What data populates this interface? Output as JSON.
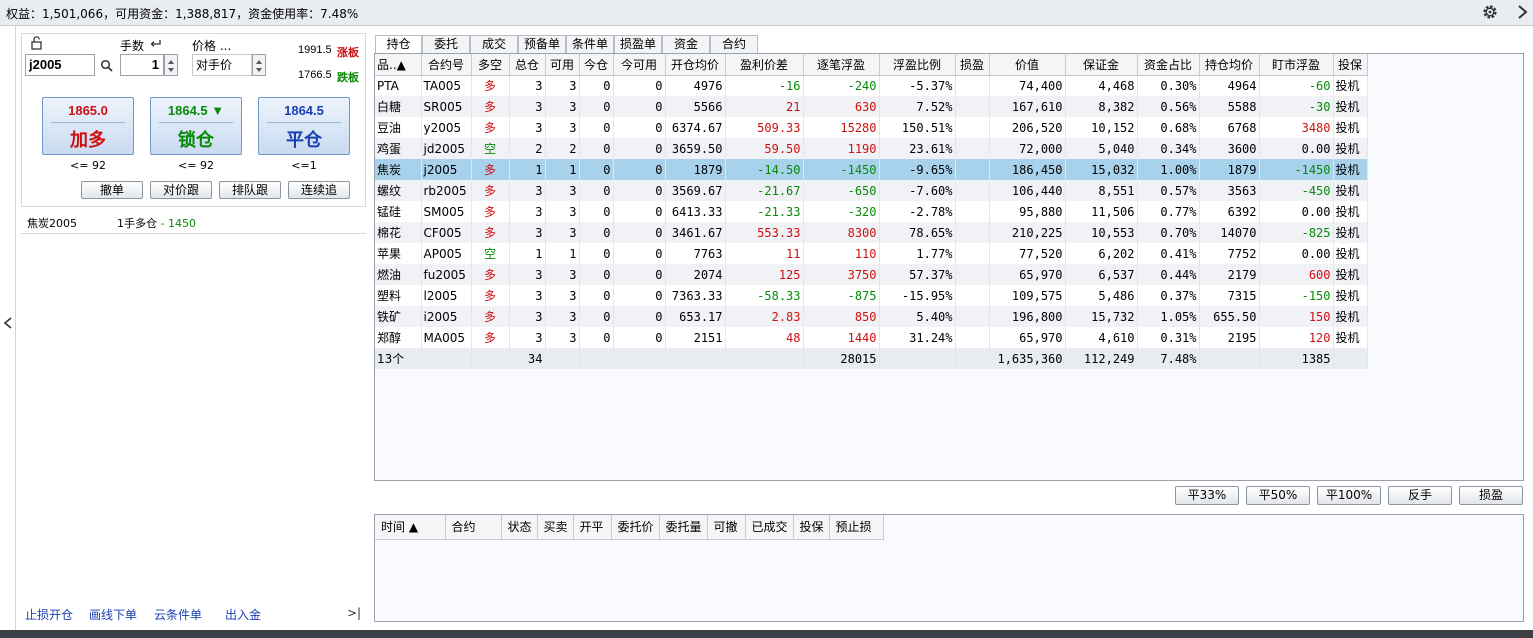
{
  "summary": {
    "text": "权益：1,501,066，可用资金：1,388,817，资金使用率：7.48%"
  },
  "icons": {
    "gear": "gear-icon",
    "more": "chevron-right-icon",
    "collapse": "chevron-left-icon",
    "unlock": "unlock-icon",
    "search": "search-icon",
    "return": "return-icon"
  },
  "order": {
    "qty_label": "手数",
    "price_label": "价格 ...",
    "contract": "j2005",
    "qty": "1",
    "price_value": "对手价",
    "limit_up": "1991.5",
    "limit_up_label": "涨板",
    "limit_down": "1766.5",
    "limit_down_label": "跌板",
    "buttons": [
      {
        "price": "1865.0",
        "label": "加多",
        "limit": "<= 92"
      },
      {
        "price": "1864.5 ▼",
        "label": "锁仓",
        "limit": "<= 92"
      },
      {
        "price": "1864.5",
        "label": "平仓",
        "limit": "<=1"
      }
    ],
    "small_buttons": [
      "撤单",
      "对价跟",
      "排队跟",
      "连续追"
    ]
  },
  "info": {
    "name": "焦炭2005",
    "pos": "1手多仓",
    "dash": " - ",
    "pl": "1450"
  },
  "bottom_links": [
    "止损开仓",
    "画线下单",
    "云条件单",
    "出入金"
  ],
  "bottom_end": ">|",
  "tabs": [
    "持仓",
    "委托",
    "成交",
    "预备单",
    "条件单",
    "损盈单",
    "资金",
    "合约"
  ],
  "positions": {
    "columns": [
      "品..▲",
      "合约号",
      "多空",
      "总仓",
      "可用",
      "今仓",
      "今可用",
      "开仓均价",
      "盈利价差",
      "逐笔浮盈",
      "浮盈比例",
      "损盈",
      "价值",
      "保证金",
      "资金占比",
      "持仓均价",
      "盯市浮盈",
      "投保"
    ],
    "rows": [
      [
        "PTA",
        "TA005",
        "多",
        "3",
        "3",
        "0",
        "0",
        "4976",
        "-16",
        "-240",
        "-5.37%",
        "",
        "74,400",
        "4,468",
        "0.30%",
        "4964",
        "-60",
        "投机"
      ],
      [
        "白糖",
        "SR005",
        "多",
        "3",
        "3",
        "0",
        "0",
        "5566",
        "21",
        "630",
        "7.52%",
        "",
        "167,610",
        "8,382",
        "0.56%",
        "5588",
        "-30",
        "投机"
      ],
      [
        "豆油",
        "y2005",
        "多",
        "3",
        "3",
        "0",
        "0",
        "6374.67",
        "509.33",
        "15280",
        "150.51%",
        "",
        "206,520",
        "10,152",
        "0.68%",
        "6768",
        "3480",
        "投机"
      ],
      [
        "鸡蛋",
        "jd2005",
        "空",
        "2",
        "2",
        "0",
        "0",
        "3659.50",
        "59.50",
        "1190",
        "23.61%",
        "",
        "72,000",
        "5,040",
        "0.34%",
        "3600",
        "0.00",
        "投机"
      ],
      [
        "焦炭",
        "j2005",
        "多",
        "1",
        "1",
        "0",
        "0",
        "1879",
        "-14.50",
        "-1450",
        "-9.65%",
        "",
        "186,450",
        "15,032",
        "1.00%",
        "1879",
        "-1450",
        "投机"
      ],
      [
        "螺纹",
        "rb2005",
        "多",
        "3",
        "3",
        "0",
        "0",
        "3569.67",
        "-21.67",
        "-650",
        "-7.60%",
        "",
        "106,440",
        "8,551",
        "0.57%",
        "3563",
        "-450",
        "投机"
      ],
      [
        "锰硅",
        "SM005",
        "多",
        "3",
        "3",
        "0",
        "0",
        "6413.33",
        "-21.33",
        "-320",
        "-2.78%",
        "",
        "95,880",
        "11,506",
        "0.77%",
        "6392",
        "0.00",
        "投机"
      ],
      [
        "棉花",
        "CF005",
        "多",
        "3",
        "3",
        "0",
        "0",
        "3461.67",
        "553.33",
        "8300",
        "78.65%",
        "",
        "210,225",
        "10,553",
        "0.70%",
        "14070",
        "-825",
        "投机"
      ],
      [
        "苹果",
        "AP005",
        "空",
        "1",
        "1",
        "0",
        "0",
        "7763",
        "11",
        "110",
        "1.77%",
        "",
        "77,520",
        "6,202",
        "0.41%",
        "7752",
        "0.00",
        "投机"
      ],
      [
        "燃油",
        "fu2005",
        "多",
        "3",
        "3",
        "0",
        "0",
        "2074",
        "125",
        "3750",
        "57.37%",
        "",
        "65,970",
        "6,537",
        "0.44%",
        "2179",
        "600",
        "投机"
      ],
      [
        "塑料",
        "l2005",
        "多",
        "3",
        "3",
        "0",
        "0",
        "7363.33",
        "-58.33",
        "-875",
        "-15.95%",
        "",
        "109,575",
        "5,486",
        "0.37%",
        "7315",
        "-150",
        "投机"
      ],
      [
        "铁矿",
        "i2005",
        "多",
        "3",
        "3",
        "0",
        "0",
        "653.17",
        "2.83",
        "850",
        "5.40%",
        "",
        "196,800",
        "15,732",
        "1.05%",
        "655.50",
        "150",
        "投机"
      ],
      [
        "郑醇",
        "MA005",
        "多",
        "3",
        "3",
        "0",
        "0",
        "2151",
        "48",
        "1440",
        "31.24%",
        "",
        "65,970",
        "4,610",
        "0.31%",
        "2195",
        "120",
        "投机"
      ]
    ],
    "total": [
      "13个",
      "",
      "",
      "34",
      "",
      "",
      "",
      "",
      "",
      "28015",
      "",
      "",
      "1,635,360",
      "112,249",
      "7.48%",
      "",
      "1385",
      ""
    ],
    "selected_row": 4
  },
  "actions": [
    "平33%",
    "平50%",
    "平100%",
    "反手",
    "损盈"
  ],
  "orders": {
    "columns": [
      "时间 ▲",
      "合约",
      "状态",
      "买卖",
      "开平",
      "委托价",
      "委托量",
      "可撤",
      "已成交",
      "投保",
      "预止损"
    ]
  }
}
